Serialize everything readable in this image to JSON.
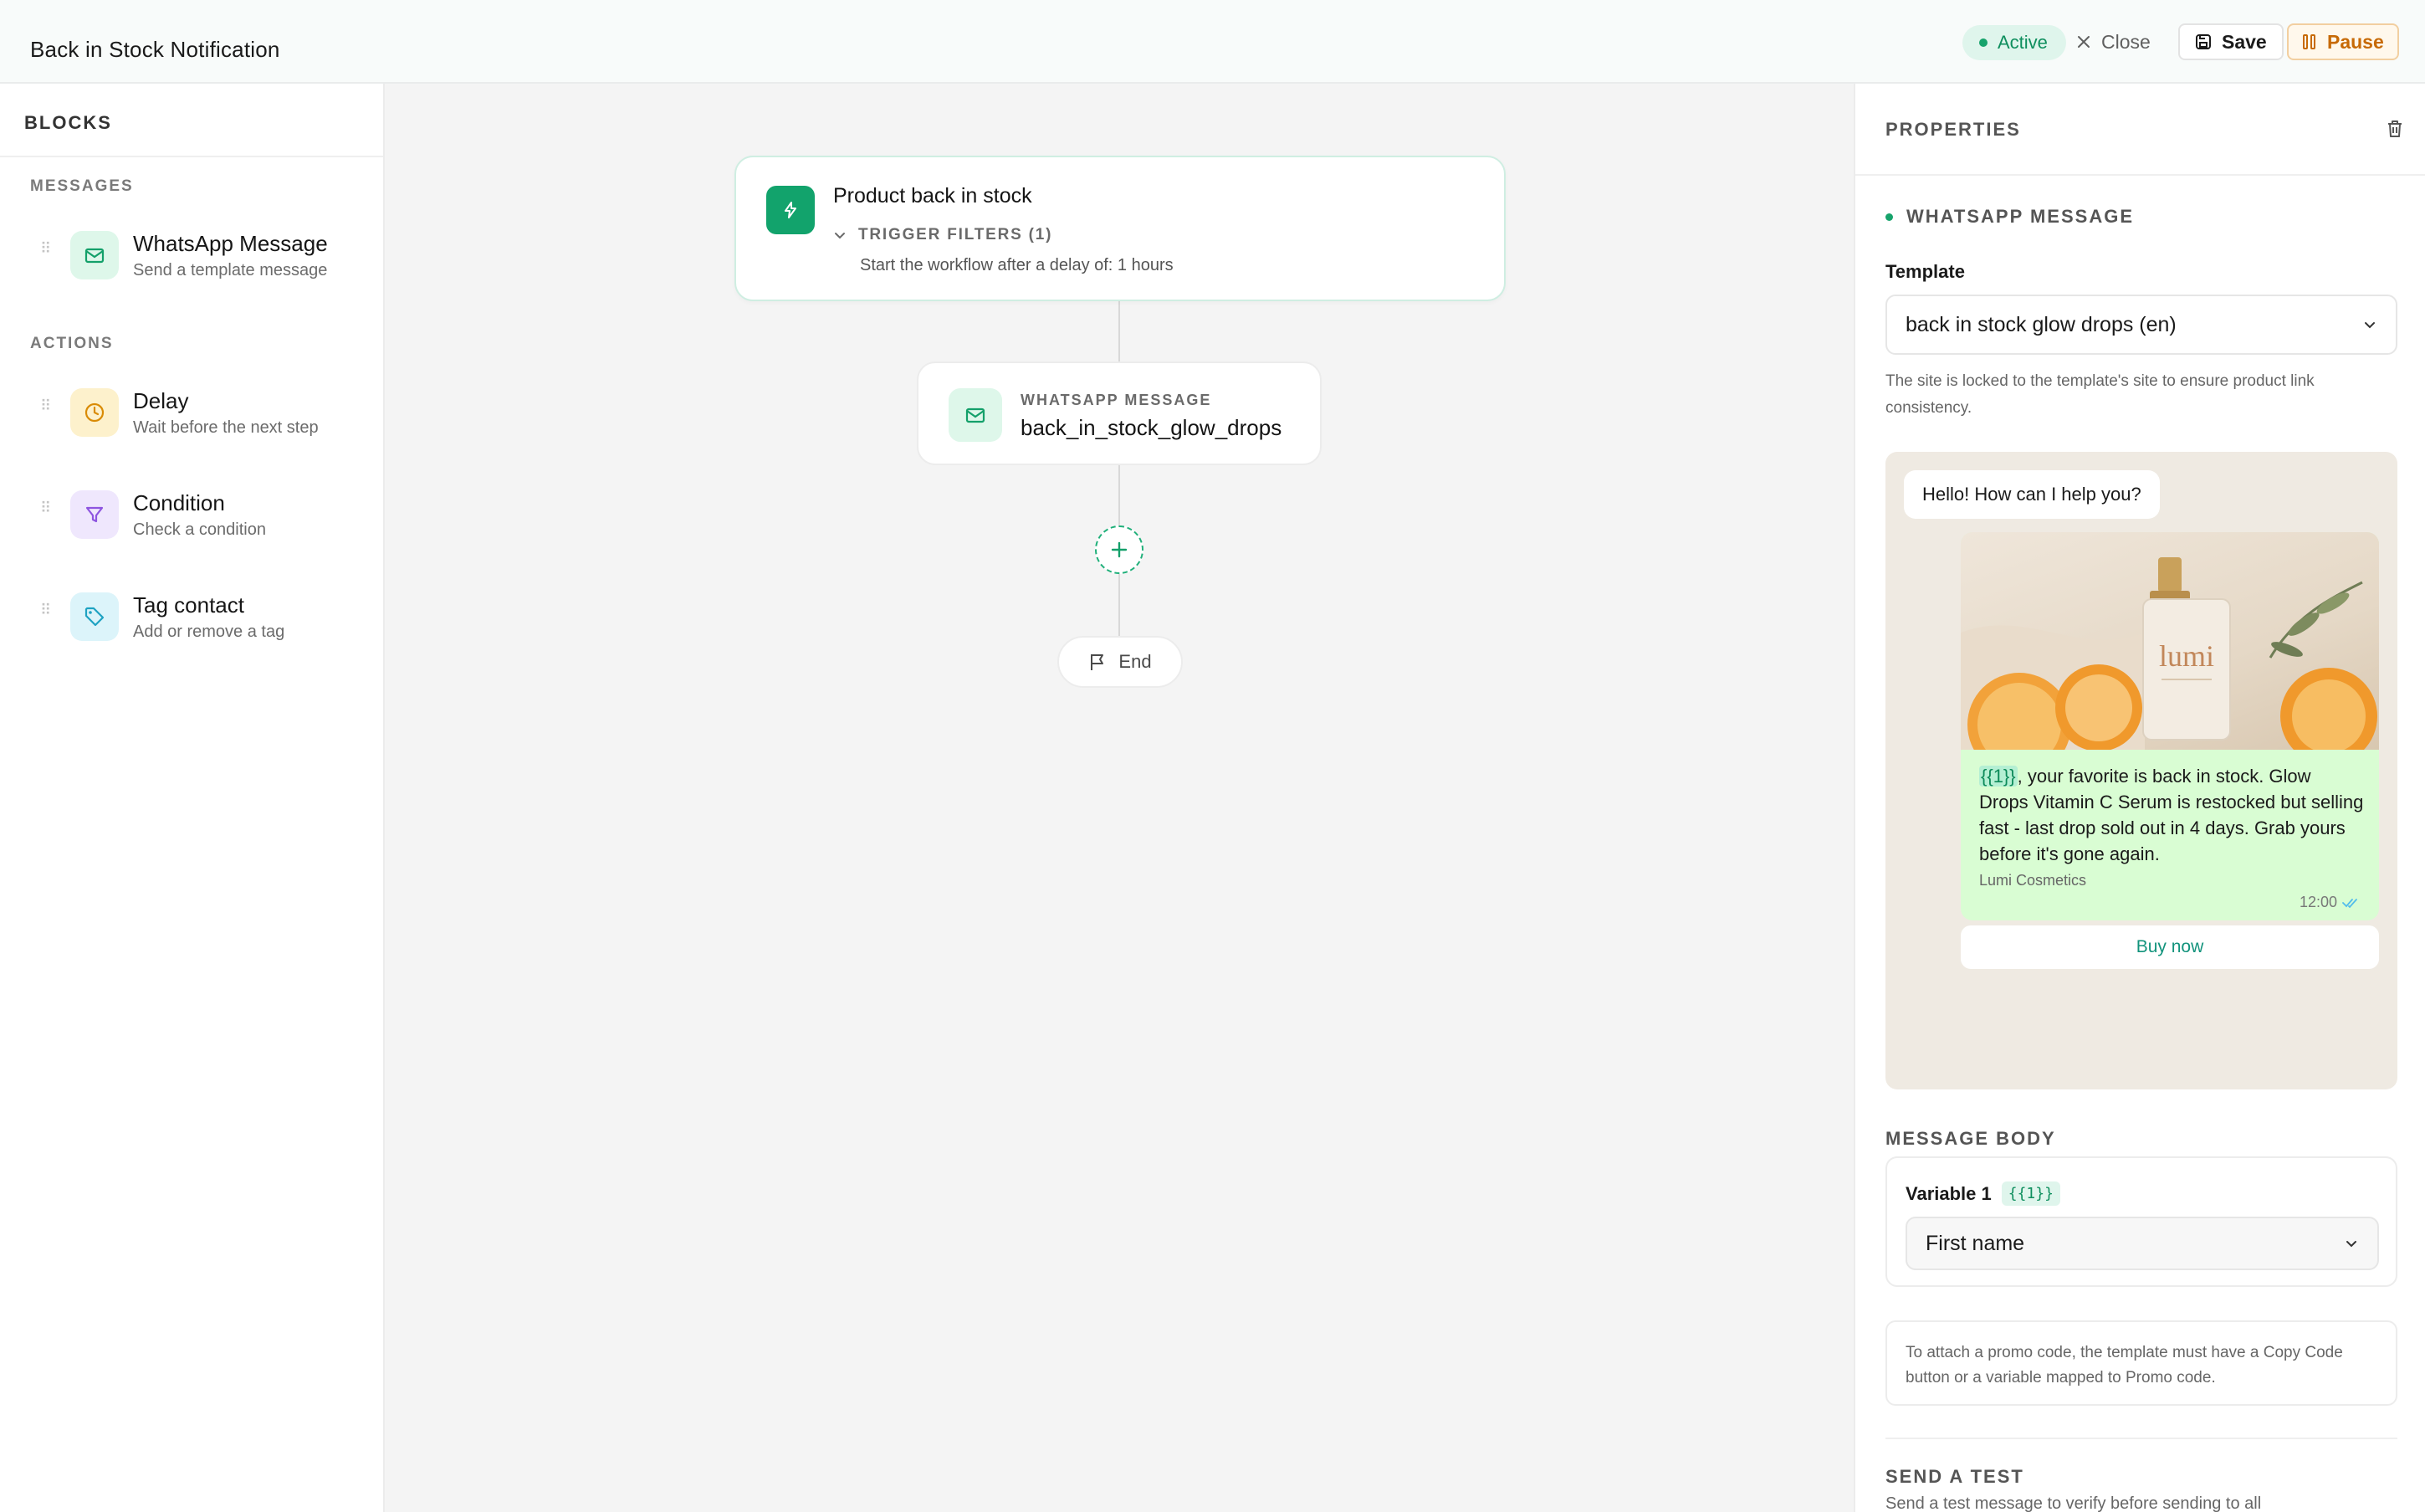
{
  "header": {
    "title": "Back in Stock Notification",
    "status": "Active",
    "close_label": "Close",
    "save_label": "Save",
    "pause_label": "Pause"
  },
  "sidebar": {
    "title": "BLOCKS",
    "messages_label": "MESSAGES",
    "actions_label": "ACTIONS",
    "messages": [
      {
        "name": "WhatsApp Message",
        "desc": "Send a template message",
        "icon": "mail-icon"
      }
    ],
    "actions": [
      {
        "name": "Delay",
        "desc": "Wait before the next step",
        "icon": "clock-icon"
      },
      {
        "name": "Condition",
        "desc": "Check a condition",
        "icon": "filter-icon"
      },
      {
        "name": "Tag contact",
        "desc": "Add or remove a tag",
        "icon": "tag-icon"
      }
    ]
  },
  "canvas": {
    "trigger": {
      "title": "Product back in stock",
      "filters_label": "TRIGGER FILTERS (1)",
      "filter_text": "Start the workflow after a delay of: 1 hours"
    },
    "message_node": {
      "type_label": "WHATSAPP MESSAGE",
      "name": "back_in_stock_glow_drops"
    },
    "end_label": "End"
  },
  "panel": {
    "title": "PROPERTIES",
    "type": "WHATSAPP MESSAGE",
    "template_label": "Template",
    "template_value": "back in stock glow drops (en)",
    "template_hint": "The site is locked to the template's site to ensure product link consistency.",
    "preview": {
      "incoming": "Hello! How can I help you?",
      "image_brand": "lumi",
      "var_token": "{{1}}",
      "body": ", your favorite is back in stock. Glow Drops Vitamin C Serum is restocked but selling fast - last drop sold out in 4 days. Grab yours before it's gone again.",
      "sender": "Lumi Cosmetics",
      "time": "12:00",
      "button": "Buy now"
    },
    "message_body_label": "MESSAGE BODY",
    "variable_label": "Variable 1",
    "variable_chip": "{{1}}",
    "variable_value": "First name",
    "promo_note": "To attach a promo code, the template must have a Copy Code button or a variable mapped to Promo code.",
    "send_test_label": "SEND A TEST",
    "send_test_desc": "Send a test message to verify before sending to all"
  },
  "colors": {
    "accent": "#14a06a",
    "pause": "#c76a06"
  }
}
